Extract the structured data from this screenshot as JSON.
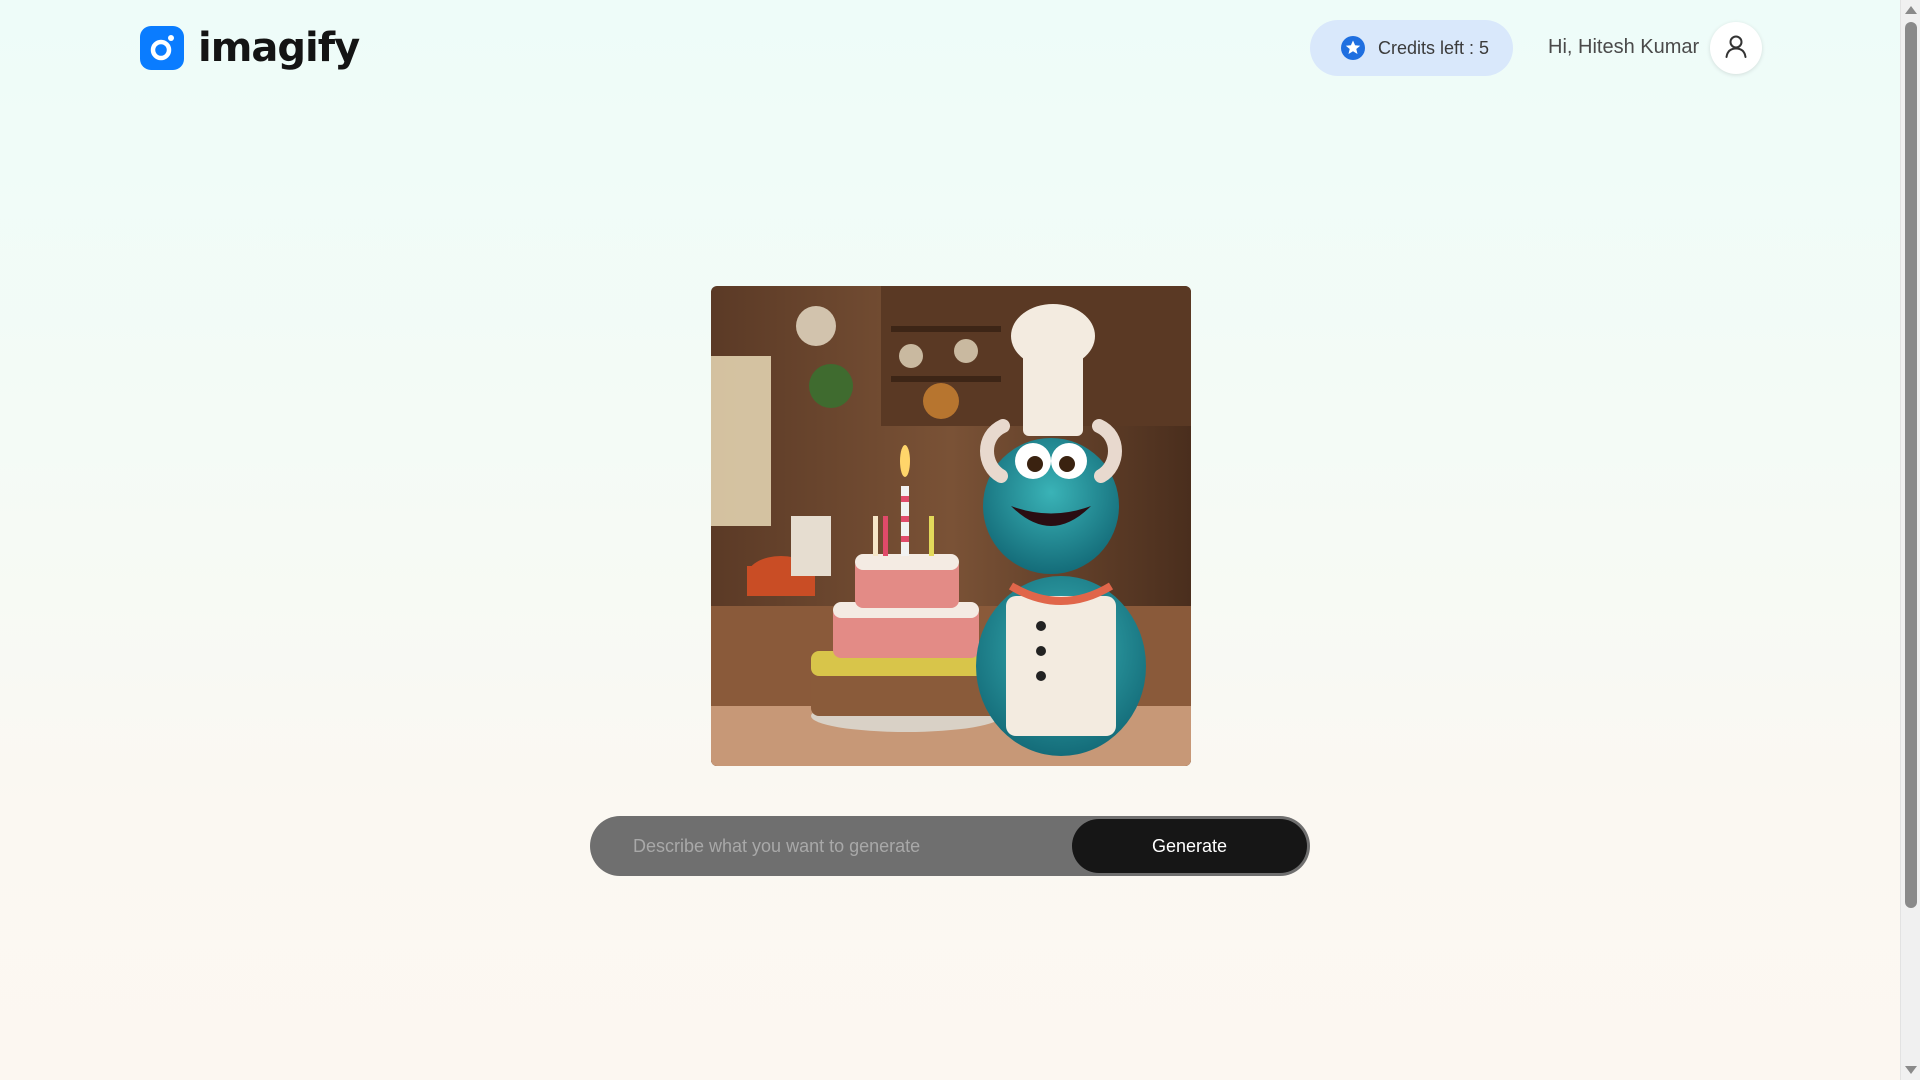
{
  "app": {
    "name": "imagify",
    "brand_color": "#0a7cff"
  },
  "header": {
    "credits_label": "Credits left : 5",
    "credits_icon": "star-icon",
    "greeting": "Hi, Hitesh Kumar",
    "avatar_icon": "user-icon"
  },
  "result": {
    "image_description": "AI generated image of a blue furry monster chef beside a three-tier birthday cake"
  },
  "prompt": {
    "placeholder": "Describe what you want to generate",
    "value": "",
    "generate_label": "Generate"
  },
  "colors": {
    "credits_bg": "#d9e8fb",
    "button_bg": "#161616",
    "prompt_bg": "#6f6f6f"
  }
}
